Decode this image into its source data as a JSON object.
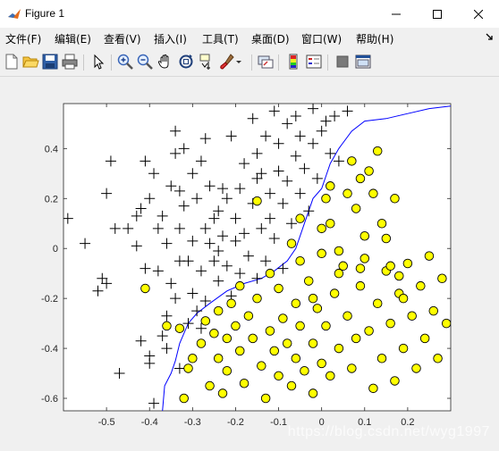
{
  "window": {
    "title": "Figure 1",
    "icons": {
      "app": "matlab-icon",
      "minimize": "minimize-icon",
      "maximize": "maximize-icon",
      "close": "close-icon"
    }
  },
  "menu": {
    "items": [
      {
        "label": "文件(F)"
      },
      {
        "label": "编辑(E)"
      },
      {
        "label": "查看(V)"
      },
      {
        "label": "插入(I)"
      },
      {
        "label": "工具(T)"
      },
      {
        "label": "桌面(D)"
      },
      {
        "label": "窗口(W)"
      },
      {
        "label": "帮助(H)"
      }
    ],
    "overflow_icon": "dock-arrow-icon"
  },
  "toolbar": {
    "buttons": [
      "new-figure-icon",
      "open-icon",
      "save-icon",
      "print-icon",
      "select-arrow-icon",
      "zoom-in-icon",
      "zoom-out-icon",
      "pan-hand-icon",
      "rotate-3d-icon",
      "data-cursor-icon",
      "brush-icon",
      "link-plot-icon",
      "colorbar-icon",
      "legend-icon",
      "hide-plot-tools-icon",
      "show-plot-tools-icon"
    ]
  },
  "colors": {
    "boundary": "#0000ff",
    "positive_marker": "#000000",
    "negative_fill": "#ffff00",
    "axes_background": "#ffffff"
  },
  "watermark": "https://blog.csdn.net/wyg1997",
  "chart_data": {
    "type": "scatter",
    "title": "",
    "xlabel": "",
    "ylabel": "",
    "xlim": [
      -0.6,
      0.3
    ],
    "ylim": [
      -0.65,
      0.58
    ],
    "xticks": [
      -0.5,
      -0.4,
      -0.3,
      -0.2,
      -0.1,
      0,
      0.1,
      0.2
    ],
    "xtick_labels": [
      "-0.5",
      "-0.4",
      "-0.3",
      "-0.2",
      "-0.1",
      "0",
      "0.1",
      "0.2"
    ],
    "yticks": [
      -0.6,
      -0.4,
      -0.2,
      0,
      0.2,
      0.4
    ],
    "ytick_labels": [
      "-0.6",
      "-0.4",
      "-0.2",
      "0",
      "0.2",
      "0.4"
    ],
    "grid": false,
    "series": [
      {
        "marker": "plus",
        "points": [
          [
            -0.59,
            0.12
          ],
          [
            -0.55,
            0.02
          ],
          [
            -0.52,
            -0.17
          ],
          [
            -0.51,
            -0.12
          ],
          [
            -0.5,
            -0.14
          ],
          [
            -0.5,
            0.22
          ],
          [
            -0.49,
            0.35
          ],
          [
            -0.48,
            0.08
          ],
          [
            -0.47,
            -0.5
          ],
          [
            -0.45,
            0.08
          ],
          [
            -0.43,
            0.01
          ],
          [
            -0.42,
            -0.37
          ],
          [
            -0.42,
            0.16
          ],
          [
            -0.41,
            0.35
          ],
          [
            -0.41,
            -0.08
          ],
          [
            -0.4,
            0.2
          ],
          [
            -0.4,
            -0.46
          ],
          [
            -0.39,
            0.3
          ],
          [
            -0.39,
            -0.62
          ],
          [
            -0.38,
            0.08
          ],
          [
            -0.38,
            -0.09
          ],
          [
            -0.37,
            -0.35
          ],
          [
            -0.37,
            0.13
          ],
          [
            -0.36,
            -0.4
          ],
          [
            -0.36,
            0.02
          ],
          [
            -0.35,
            0.25
          ],
          [
            -0.35,
            -0.14
          ],
          [
            -0.34,
            0.47
          ],
          [
            -0.34,
            0.38
          ],
          [
            -0.34,
            -0.2
          ],
          [
            -0.33,
            -0.48
          ],
          [
            -0.33,
            0.08
          ],
          [
            -0.33,
            -0.05
          ],
          [
            -0.32,
            0.4
          ],
          [
            -0.32,
            0.17
          ],
          [
            -0.31,
            -0.3
          ],
          [
            -0.31,
            -0.05
          ],
          [
            -0.3,
            0.3
          ],
          [
            -0.3,
            -0.18
          ],
          [
            -0.3,
            0.03
          ],
          [
            -0.29,
            0.2
          ],
          [
            -0.29,
            -0.25
          ],
          [
            -0.28,
            0.35
          ],
          [
            -0.28,
            -0.09
          ],
          [
            -0.27,
            0.08
          ],
          [
            -0.27,
            -0.21
          ],
          [
            -0.26,
            0.25
          ],
          [
            -0.26,
            0.02
          ],
          [
            -0.25,
            -0.05
          ],
          [
            -0.25,
            0.12
          ],
          [
            -0.24,
            -0.01
          ],
          [
            -0.24,
            0.15
          ],
          [
            -0.24,
            -0.13
          ],
          [
            -0.23,
            0.24
          ],
          [
            -0.23,
            0.05
          ],
          [
            -0.22,
            -0.07
          ],
          [
            -0.22,
            0.2
          ],
          [
            -0.21,
            0.45
          ],
          [
            -0.21,
            -0.19
          ],
          [
            -0.2,
            0.03
          ],
          [
            -0.2,
            0.12
          ],
          [
            -0.19,
            0.24
          ],
          [
            -0.19,
            -0.1
          ],
          [
            -0.18,
            0.34
          ],
          [
            -0.18,
            0.06
          ],
          [
            -0.17,
            -0.03
          ],
          [
            -0.16,
            0.18
          ],
          [
            -0.16,
            0.52
          ],
          [
            -0.15,
            0.38
          ],
          [
            -0.15,
            -0.12
          ],
          [
            -0.14,
            0.3
          ],
          [
            -0.14,
            0.08
          ],
          [
            -0.13,
            0.45
          ],
          [
            -0.13,
            -0.05
          ],
          [
            -0.12,
            0.22
          ],
          [
            -0.12,
            0.12
          ],
          [
            -0.11,
            0.55
          ],
          [
            -0.11,
            0.04
          ],
          [
            -0.1,
            0.42
          ],
          [
            -0.1,
            0.31
          ],
          [
            -0.09,
            0.18
          ],
          [
            -0.09,
            -0.08
          ],
          [
            -0.08,
            0.5
          ],
          [
            -0.08,
            0.27
          ],
          [
            -0.07,
            0.1
          ],
          [
            -0.06,
            0.53
          ],
          [
            -0.06,
            0.37
          ],
          [
            -0.05,
            0.22
          ],
          [
            -0.05,
            0.45
          ],
          [
            -0.04,
            0.32
          ],
          [
            -0.03,
            0.15
          ],
          [
            -0.02,
            0.56
          ],
          [
            -0.02,
            0.42
          ],
          [
            -0.01,
            0.28
          ],
          [
            0.0,
            0.47
          ],
          [
            0.01,
            0.51
          ],
          [
            0.02,
            0.38
          ],
          [
            0.03,
            0.53
          ],
          [
            0.04,
            0.35
          ],
          [
            0.06,
            0.55
          ],
          [
            -0.43,
            0.13
          ],
          [
            -0.33,
            0.23
          ],
          [
            -0.27,
            0.44
          ],
          [
            -0.28,
            -0.32
          ],
          [
            -0.36,
            -0.27
          ],
          [
            -0.4,
            -0.43
          ],
          [
            -0.15,
            0.28
          ]
        ]
      },
      {
        "marker": "circle",
        "points": [
          [
            -0.41,
            -0.16
          ],
          [
            -0.36,
            -0.31
          ],
          [
            -0.33,
            -0.32
          ],
          [
            -0.32,
            -0.6
          ],
          [
            -0.31,
            -0.48
          ],
          [
            -0.3,
            -0.44
          ],
          [
            -0.28,
            -0.38
          ],
          [
            -0.27,
            -0.29
          ],
          [
            -0.26,
            -0.55
          ],
          [
            -0.25,
            -0.34
          ],
          [
            -0.24,
            -0.44
          ],
          [
            -0.24,
            -0.25
          ],
          [
            -0.23,
            -0.58
          ],
          [
            -0.22,
            -0.36
          ],
          [
            -0.22,
            -0.49
          ],
          [
            -0.21,
            -0.22
          ],
          [
            -0.2,
            -0.31
          ],
          [
            -0.19,
            -0.41
          ],
          [
            -0.19,
            -0.15
          ],
          [
            -0.18,
            -0.54
          ],
          [
            -0.17,
            -0.27
          ],
          [
            -0.16,
            -0.36
          ],
          [
            -0.15,
            -0.2
          ],
          [
            -0.14,
            -0.47
          ],
          [
            -0.13,
            -0.6
          ],
          [
            -0.12,
            -0.33
          ],
          [
            -0.11,
            -0.41
          ],
          [
            -0.1,
            -0.16
          ],
          [
            -0.1,
            -0.51
          ],
          [
            -0.09,
            -0.28
          ],
          [
            -0.08,
            -0.38
          ],
          [
            -0.07,
            -0.55
          ],
          [
            -0.06,
            -0.44
          ],
          [
            -0.06,
            -0.22
          ],
          [
            -0.05,
            -0.31
          ],
          [
            -0.04,
            -0.49
          ],
          [
            -0.03,
            -0.13
          ],
          [
            -0.02,
            -0.38
          ],
          [
            -0.02,
            -0.58
          ],
          [
            -0.01,
            -0.24
          ],
          [
            0.0,
            -0.46
          ],
          [
            0.0,
            -0.02
          ],
          [
            0.01,
            -0.31
          ],
          [
            0.02,
            -0.51
          ],
          [
            0.03,
            -0.18
          ],
          [
            0.04,
            -0.4
          ],
          [
            0.05,
            -0.07
          ],
          [
            0.06,
            -0.27
          ],
          [
            0.07,
            -0.48
          ],
          [
            0.08,
            -0.36
          ],
          [
            0.09,
            -0.15
          ],
          [
            0.1,
            -0.04
          ],
          [
            0.11,
            -0.33
          ],
          [
            0.12,
            -0.56
          ],
          [
            0.13,
            -0.22
          ],
          [
            0.14,
            -0.44
          ],
          [
            0.15,
            -0.09
          ],
          [
            0.16,
            -0.3
          ],
          [
            0.17,
            -0.53
          ],
          [
            0.18,
            -0.18
          ],
          [
            0.19,
            -0.4
          ],
          [
            0.2,
            -0.06
          ],
          [
            0.21,
            -0.27
          ],
          [
            0.22,
            -0.48
          ],
          [
            0.23,
            -0.15
          ],
          [
            0.24,
            -0.36
          ],
          [
            0.25,
            -0.03
          ],
          [
            0.26,
            -0.25
          ],
          [
            0.27,
            -0.44
          ],
          [
            0.28,
            -0.12
          ],
          [
            -0.15,
            0.19
          ],
          [
            -0.05,
            0.12
          ],
          [
            0.0,
            0.08
          ],
          [
            0.01,
            0.2
          ],
          [
            0.02,
            0.25
          ],
          [
            0.04,
            -0.01
          ],
          [
            0.06,
            0.22
          ],
          [
            0.07,
            0.35
          ],
          [
            0.08,
            0.16
          ],
          [
            0.09,
            0.28
          ],
          [
            0.1,
            0.05
          ],
          [
            0.11,
            0.31
          ],
          [
            0.12,
            0.22
          ],
          [
            0.13,
            0.39
          ],
          [
            0.14,
            0.1
          ],
          [
            0.15,
            0.04
          ],
          [
            0.16,
            -0.07
          ],
          [
            0.17,
            0.2
          ],
          [
            0.18,
            -0.11
          ],
          [
            0.19,
            -0.2
          ],
          [
            -0.05,
            -0.05
          ],
          [
            -0.07,
            0.02
          ],
          [
            -0.12,
            -0.1
          ],
          [
            -0.02,
            -0.2
          ],
          [
            0.04,
            -0.1
          ],
          [
            0.09,
            -0.08
          ],
          [
            0.29,
            -0.3
          ],
          [
            0.02,
            0.1
          ]
        ]
      }
    ],
    "boundary": [
      [
        -0.37,
        -0.65
      ],
      [
        -0.365,
        -0.55
      ],
      [
        -0.35,
        -0.5
      ],
      [
        -0.34,
        -0.45
      ],
      [
        -0.33,
        -0.38
      ],
      [
        -0.31,
        -0.3
      ],
      [
        -0.29,
        -0.26
      ],
      [
        -0.26,
        -0.22
      ],
      [
        -0.22,
        -0.17
      ],
      [
        -0.18,
        -0.14
      ],
      [
        -0.14,
        -0.12
      ],
      [
        -0.11,
        -0.09
      ],
      [
        -0.08,
        -0.05
      ],
      [
        -0.06,
        0.0
      ],
      [
        -0.05,
        0.05
      ],
      [
        -0.04,
        0.1
      ],
      [
        -0.03,
        0.15
      ],
      [
        -0.02,
        0.2
      ],
      [
        0.0,
        0.24
      ],
      [
        0.01,
        0.29
      ],
      [
        0.02,
        0.34
      ],
      [
        0.04,
        0.4
      ],
      [
        0.07,
        0.47
      ],
      [
        0.1,
        0.51
      ],
      [
        0.15,
        0.52
      ],
      [
        0.2,
        0.54
      ],
      [
        0.25,
        0.56
      ],
      [
        0.3,
        0.57
      ]
    ]
  }
}
